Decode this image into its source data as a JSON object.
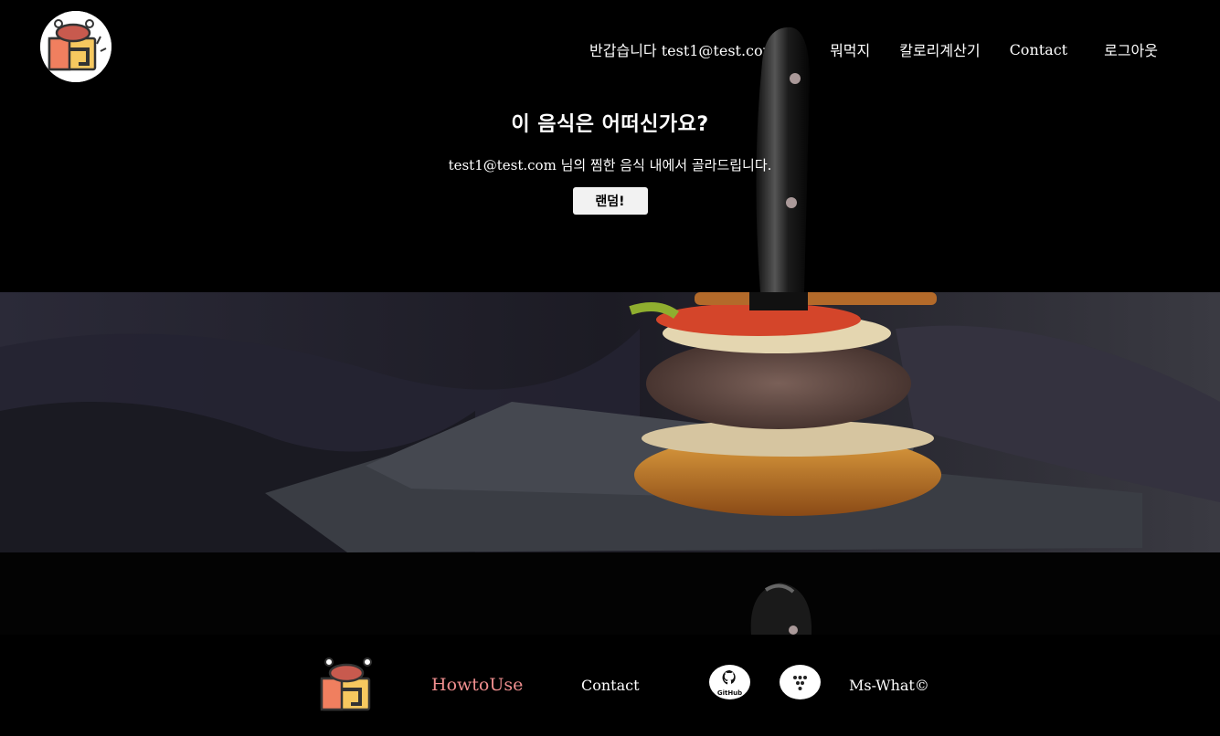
{
  "header": {
    "greeting": "반갑습니다 test1@test.com 님!",
    "nav": [
      "뭐먹지",
      "칼로리계산기",
      "Contact",
      "로그아웃"
    ]
  },
  "hero": {
    "title": "이 음식은 어떠신가요?",
    "subtitle": "test1@test.com 님의 찜한 음식 내에서 골라드립니다.",
    "button": "랜덤!"
  },
  "footer": {
    "howto": "HowtoUse",
    "contact": "Contact",
    "github_text": "GitHub",
    "copyright": "Ms-What©"
  },
  "colors": {
    "background": "#000000",
    "howto_link": "#f08f8f",
    "button_bg": "#f2f2f2"
  }
}
